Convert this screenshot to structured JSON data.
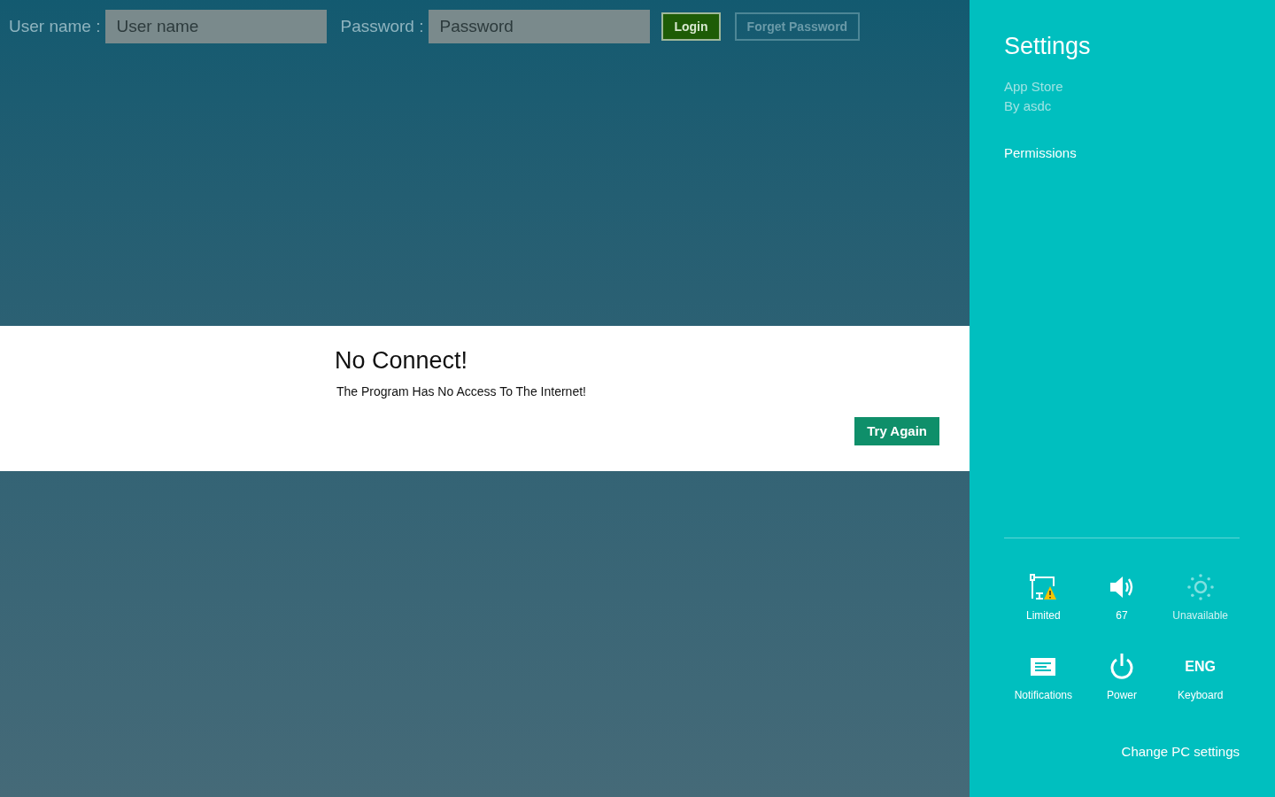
{
  "login_bar": {
    "username_label": "User name :",
    "username": {
      "placeholder": "User name"
    },
    "password_label": "Password :",
    "password": {
      "placeholder": "Password"
    },
    "buttons": [
      {
        "label": "Login",
        "disabled": false
      },
      {
        "label": "Forget Password",
        "disabled": true
      }
    ]
  },
  "dialog": {
    "title": "No Connect!",
    "message": "The Program Has No Access To The Internet!",
    "button": "Try Again"
  },
  "settings": {
    "title": "Settings",
    "app_name": "App Store",
    "publisher": "By asdc",
    "links": [
      "Permissions"
    ],
    "tiles": [
      {
        "kind": "network",
        "label": "Limited",
        "disabled": false
      },
      {
        "kind": "volume",
        "label": "67",
        "disabled": false
      },
      {
        "kind": "brightness",
        "label": "Unavailable",
        "disabled": true
      },
      {
        "kind": "notifications",
        "label": "Notifications",
        "disabled": false
      },
      {
        "kind": "power",
        "label": "Power",
        "disabled": false
      },
      {
        "kind": "keyboard",
        "glyph": "ENG",
        "label": "Keyboard",
        "disabled": false
      }
    ],
    "footer_link": "Change PC settings"
  }
}
